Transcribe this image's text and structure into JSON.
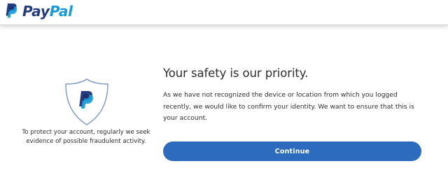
{
  "header": {
    "logo_text_pay": "Pay",
    "logo_text_pal": "Pal",
    "logo_icon": "paypal-logo-icon",
    "brand_dark": "#253b80",
    "brand_light": "#179bd7"
  },
  "left_panel": {
    "icon": "shield-paypal-icon",
    "caption": "To protect your account, regularly we seek evidence of possible fraudulent activity."
  },
  "main": {
    "title": "Your safety is our priority.",
    "body": "As we have not recognized the device or location from which you logged recently, we would like to confirm your identity. We want to ensure that this is your account.",
    "continue_label": "Continue",
    "button_color": "#2c6bbd"
  }
}
